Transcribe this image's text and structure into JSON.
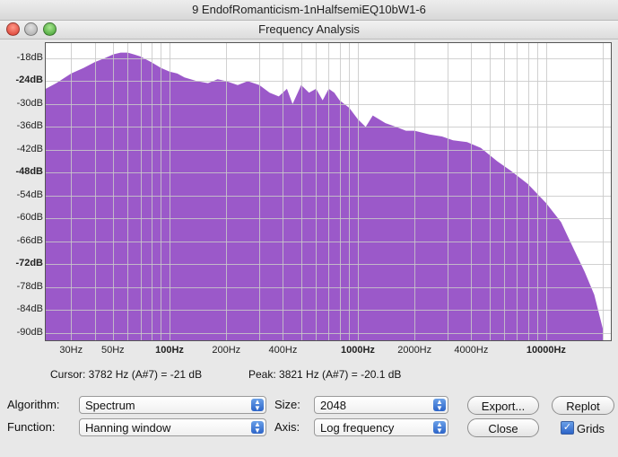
{
  "window": {
    "title": "9 EndofRomanticism-1nHalfsemiEQ10bW1-6",
    "dialog_title": "Frequency Analysis"
  },
  "plot": {
    "y_labels": [
      {
        "text": "-18dB",
        "bold": false
      },
      {
        "text": "-24dB",
        "bold": true
      },
      {
        "text": "-30dB",
        "bold": false
      },
      {
        "text": "-36dB",
        "bold": false
      },
      {
        "text": "-42dB",
        "bold": false
      },
      {
        "text": "-48dB",
        "bold": true
      },
      {
        "text": "-54dB",
        "bold": false
      },
      {
        "text": "-60dB",
        "bold": false
      },
      {
        "text": "-66dB",
        "bold": false
      },
      {
        "text": "-72dB",
        "bold": true
      },
      {
        "text": "-78dB",
        "bold": false
      },
      {
        "text": "-84dB",
        "bold": false
      },
      {
        "text": "-90dB",
        "bold": false
      }
    ],
    "x_labels": [
      {
        "text": "30Hz",
        "bold": false
      },
      {
        "text": "50Hz",
        "bold": false
      },
      {
        "text": "100Hz",
        "bold": true
      },
      {
        "text": "200Hz",
        "bold": false
      },
      {
        "text": "400Hz",
        "bold": false
      },
      {
        "text": "1000Hz",
        "bold": true
      },
      {
        "text": "2000Hz",
        "bold": false
      },
      {
        "text": "4000Hz",
        "bold": false
      },
      {
        "text": "10000Hz",
        "bold": true
      }
    ],
    "fill_color": "#9b59c9"
  },
  "cursor": {
    "text": "Cursor: 3782 Hz (A#7) = -21 dB"
  },
  "peak": {
    "text": "Peak: 3821 Hz (A#7) = -20.1 dB"
  },
  "controls": {
    "algorithm_label": "Algorithm:",
    "algorithm_value": "Spectrum",
    "function_label": "Function:",
    "function_value": "Hanning window",
    "size_label": "Size:",
    "size_value": "2048",
    "axis_label": "Axis:",
    "axis_value": "Log frequency",
    "export_label": "Export...",
    "replot_label": "Replot",
    "close_label": "Close",
    "grids_label": "Grids",
    "grids_checked": true
  },
  "chart_data": {
    "type": "area",
    "xlabel": "",
    "ylabel": "",
    "x_scale": "log",
    "x": [
      22,
      25,
      30,
      35,
      40,
      45,
      50,
      55,
      60,
      65,
      70,
      80,
      90,
      100,
      110,
      120,
      140,
      160,
      180,
      200,
      230,
      260,
      300,
      340,
      380,
      420,
      450,
      500,
      550,
      600,
      650,
      700,
      750,
      800,
      900,
      1000,
      1100,
      1200,
      1400,
      1600,
      1800,
      2000,
      2400,
      2800,
      3200,
      3800,
      4500,
      5500,
      6500,
      8000,
      10000,
      12000,
      14000,
      16000,
      18000,
      20000
    ],
    "y": [
      -26,
      -24.5,
      -22,
      -20.5,
      -19,
      -18,
      -17,
      -16.5,
      -16.5,
      -17,
      -17.5,
      -19,
      -20.5,
      -21.5,
      -22,
      -23,
      -24,
      -24.5,
      -23.5,
      -24,
      -25,
      -24,
      -25,
      -27,
      -28,
      -26,
      -30,
      -25,
      -27,
      -26,
      -29,
      -26,
      -27,
      -29,
      -31,
      -34,
      -36,
      -33,
      -35,
      -36,
      -37,
      -37,
      -38,
      -38.5,
      -39.5,
      -40,
      -41.5,
      -45,
      -47.5,
      -51,
      -56,
      -61,
      -68,
      -74,
      -80,
      -89
    ],
    "ylim": [
      -92,
      -14
    ],
    "xlim": [
      22,
      22050
    ],
    "grid": true
  }
}
